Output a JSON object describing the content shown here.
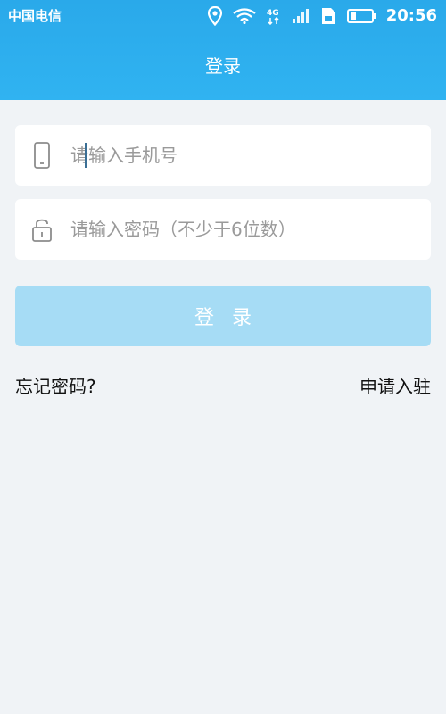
{
  "status_bar": {
    "carrier": "中国电信",
    "network_label": "4G",
    "time": "20:56"
  },
  "header": {
    "title": "登录"
  },
  "form": {
    "phone_placeholder": "请输入手机号",
    "password_placeholder": "请输入密码（不少于6位数）",
    "phone_icon": "phone-icon",
    "lock_icon": "lock-icon",
    "login_button_label": "登录",
    "forgot_password_label": "忘记密码?",
    "apply_label": "申请入驻"
  },
  "colors": {
    "header": "#30b3f1",
    "background": "#f0f3f6",
    "button_disabled": "#a6dcf5",
    "field_bg": "#ffffff",
    "placeholder": "#9a9a9a"
  }
}
